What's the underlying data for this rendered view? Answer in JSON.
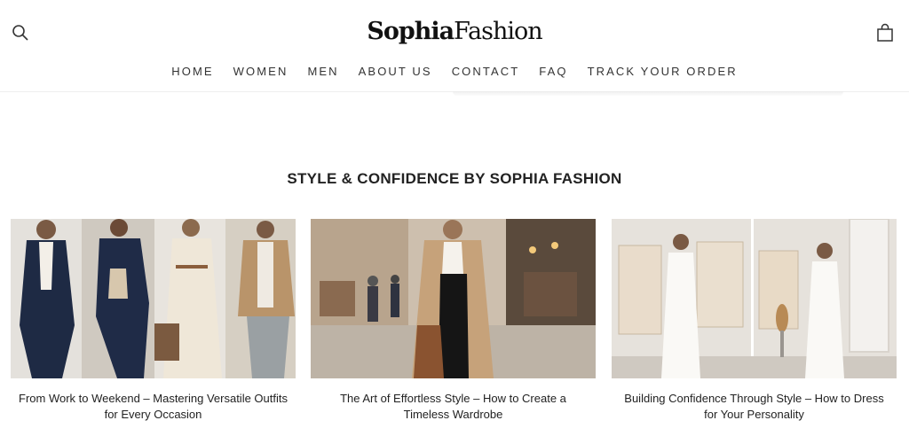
{
  "brand": {
    "logo_bold": "Sophia",
    "logo_regular": "Fashion"
  },
  "header": {
    "search_icon": "search-icon",
    "cart_icon": "shopping-bag-icon"
  },
  "nav": {
    "items": [
      "HOME",
      "WOMEN",
      "MEN",
      "ABOUT US",
      "CONTACT",
      "FAQ",
      "TRACK YOUR ORDER"
    ]
  },
  "section": {
    "title": "STYLE & CONFIDENCE BY SOPHIA FASHION"
  },
  "posts": [
    {
      "caption": "From Work to Weekend – Mastering Versatile Outfits for Every Occasion"
    },
    {
      "caption": "The Art of Effortless Style – How to Create a Timeless Wardrobe"
    },
    {
      "caption": "Building Confidence Through Style – How to Dress for Your Personality"
    }
  ],
  "colors": {
    "text": "#1a1a1a",
    "nav": "#333333",
    "navy": "#1e2a44",
    "camel": "#b08a60"
  }
}
